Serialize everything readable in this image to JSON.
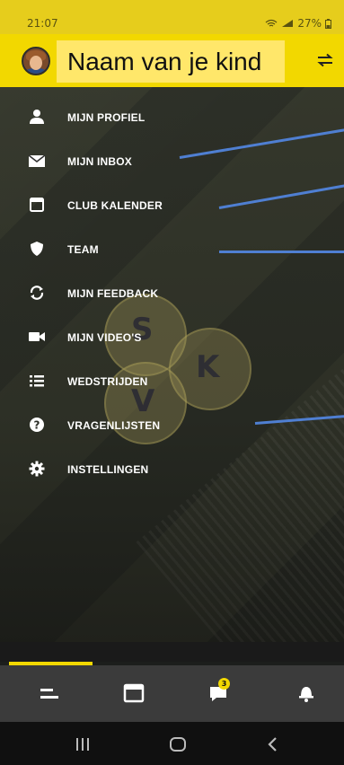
{
  "status_bar": {
    "time": "21:07",
    "battery": "27%"
  },
  "header": {
    "title": "Naam van je kind"
  },
  "menu": {
    "items": [
      {
        "label": "MIJN PROFIEL",
        "icon": "person-icon"
      },
      {
        "label": "MIJN INBOX",
        "icon": "mail-icon"
      },
      {
        "label": "CLUB KALENDER",
        "icon": "calendar-icon"
      },
      {
        "label": "TEAM",
        "icon": "shield-icon"
      },
      {
        "label": "MIJN FEEDBACK",
        "icon": "refresh-icon"
      },
      {
        "label": "MIJN VIDEO'S",
        "icon": "video-camera-icon"
      },
      {
        "label": "WEDSTRIJDEN",
        "icon": "list-icon"
      },
      {
        "label": "VRAGENLIJSTEN",
        "icon": "help-circle-icon"
      },
      {
        "label": "INSTELLINGEN",
        "icon": "gear-icon"
      }
    ]
  },
  "logo": {
    "letters": [
      "S",
      "K",
      "V"
    ]
  },
  "bottom_nav": {
    "items": [
      "menu-icon",
      "calendar-icon",
      "chat-icon",
      "bell-icon"
    ],
    "chat_badge": "3",
    "active_index": 0
  },
  "colors": {
    "accent": "#f2d800",
    "pointer_lines": "#4f7fd2"
  }
}
